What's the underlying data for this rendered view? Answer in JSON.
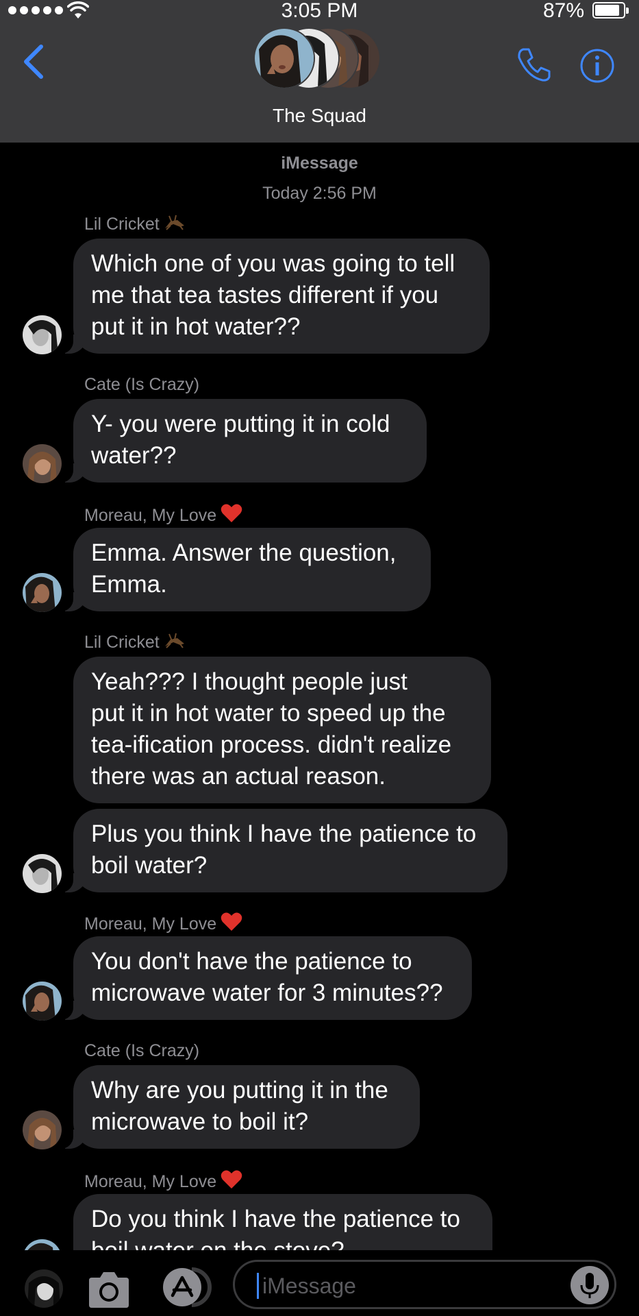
{
  "status_bar": {
    "time": "3:05 PM",
    "battery_percent_text": "87%",
    "battery_level": 0.87
  },
  "header": {
    "title": "The Squad"
  },
  "thread": {
    "service": "iMessage",
    "timestamp_day": "Today",
    "timestamp_time": "2:56 PM"
  },
  "messages": [
    {
      "sender": "Lil Cricket",
      "sender_emoji": "cricket-emoji",
      "lines": [
        "Which one of you was going to tell",
        "me that tea tastes different if you",
        "put it in hot water??"
      ]
    },
    {
      "sender": "Cate (Is Crazy)",
      "lines": [
        "Y- you were putting it in cold",
        "water??"
      ]
    },
    {
      "sender": "Moreau, My Love",
      "sender_emoji": "red-heart-emoji",
      "lines": [
        "Emma. Answer the question,",
        "Emma."
      ]
    },
    {
      "sender": "Lil Cricket",
      "sender_emoji": "cricket-emoji",
      "lines": [
        "Yeah??? I thought people just",
        "put it in hot water to speed up the",
        "tea-ification process. didn't realize",
        "there was an actual reason."
      ]
    },
    {
      "lines": [
        "Plus you think I have the patience to",
        "boil water?"
      ]
    },
    {
      "sender": "Moreau, My Love",
      "sender_emoji": "red-heart-emoji",
      "lines": [
        "You don't have the patience to",
        "microwave water for 3 minutes??"
      ]
    },
    {
      "sender": "Cate (Is Crazy)",
      "lines": [
        "Why are you putting it in the",
        "microwave to boil it?"
      ]
    },
    {
      "sender": "Moreau, My Love",
      "sender_emoji": "red-heart-emoji",
      "lines": [
        "Do you think I have the patience to",
        "boil water on the stove?"
      ]
    }
  ],
  "composer": {
    "placeholder": "iMessage"
  },
  "colors": {
    "accent": "#3f87ff",
    "bubble": "#262629",
    "header": "#3a3a3c",
    "meta": "#8e8e93",
    "heart": "#e0322b"
  }
}
